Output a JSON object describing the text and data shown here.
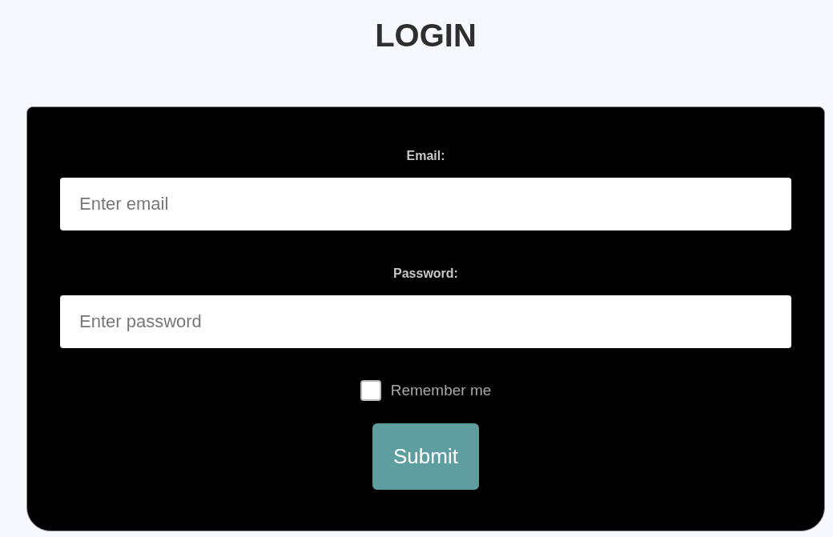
{
  "title": "LOGIN",
  "form": {
    "fields": [
      {
        "label": "Email:",
        "placeholder": "Enter email"
      },
      {
        "label": "Password:",
        "placeholder": "Enter password"
      }
    ],
    "remember": {
      "label": "Remember me",
      "checked": false
    },
    "submit": "Submit"
  }
}
